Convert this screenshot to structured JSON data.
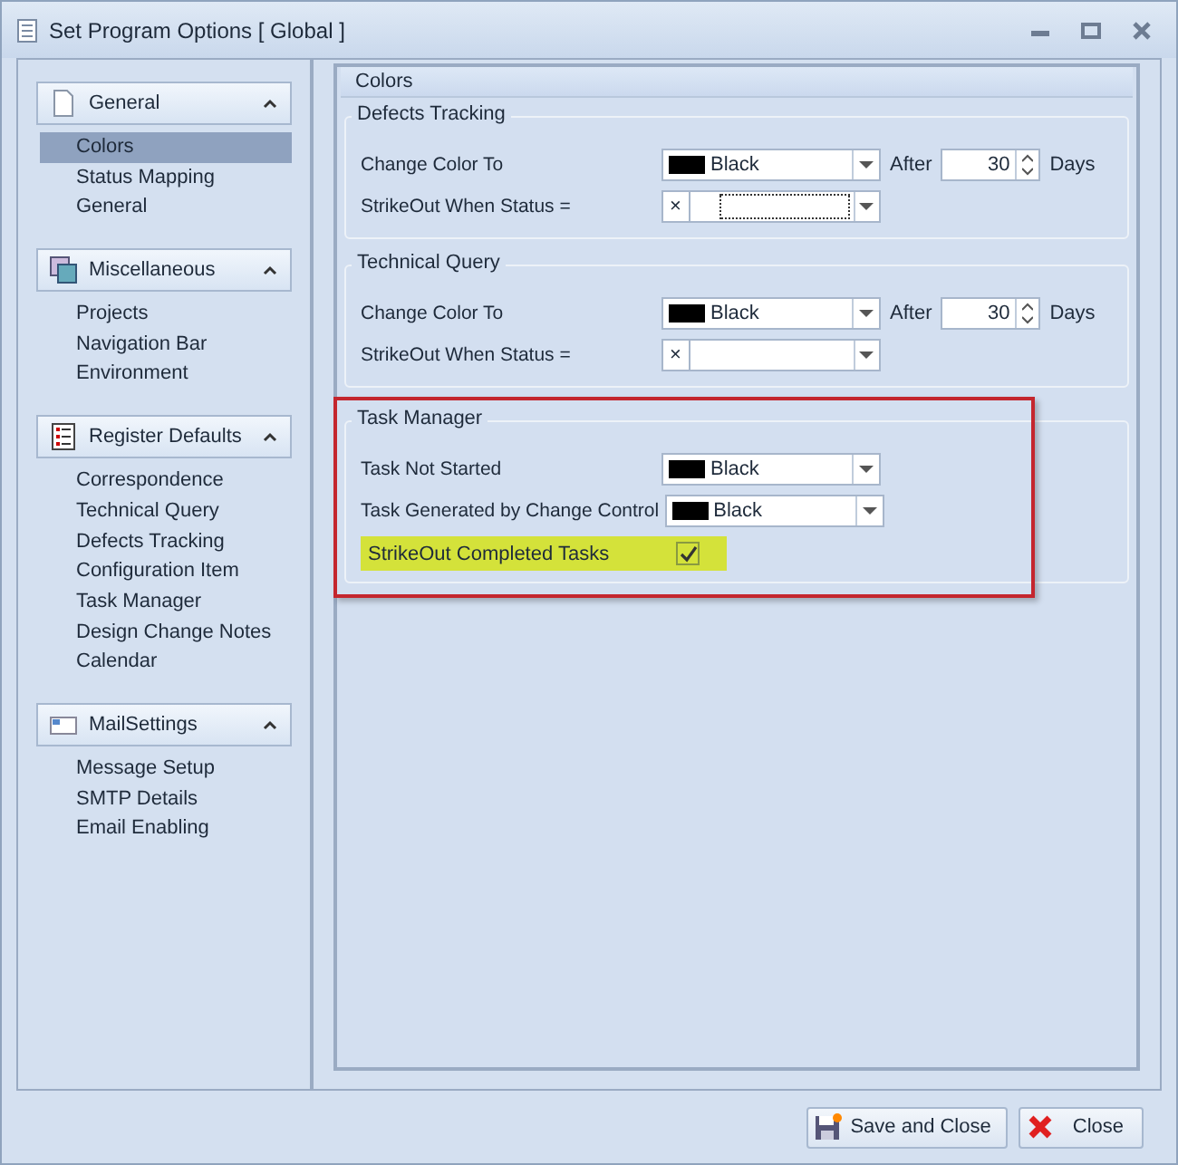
{
  "window": {
    "title": "Set Program Options [ Global ]"
  },
  "sidebar": [
    {
      "title": "General",
      "expanded": true,
      "items": [
        {
          "label": "Colors",
          "selected": true
        },
        {
          "label": "Status Mapping",
          "selected": false
        },
        {
          "label": "General",
          "selected": false
        }
      ]
    },
    {
      "title": "Miscellaneous",
      "expanded": true,
      "items": [
        {
          "label": "Projects",
          "selected": false
        },
        {
          "label": "Navigation Bar",
          "selected": false
        },
        {
          "label": "Environment",
          "selected": false
        }
      ]
    },
    {
      "title": "Register Defaults",
      "expanded": true,
      "items": [
        {
          "label": "Correspondence",
          "selected": false
        },
        {
          "label": "Technical Query",
          "selected": false
        },
        {
          "label": "Defects Tracking",
          "selected": false
        },
        {
          "label": "Configuration Item",
          "selected": false
        },
        {
          "label": "Task Manager",
          "selected": false
        },
        {
          "label": "Design Change Notes",
          "selected": false
        },
        {
          "label": "Calendar",
          "selected": false
        }
      ]
    },
    {
      "title": "MailSettings",
      "expanded": true,
      "items": [
        {
          "label": "Message Setup",
          "selected": false
        },
        {
          "label": "SMTP Details",
          "selected": false
        },
        {
          "label": "Email Enabling",
          "selected": false
        }
      ]
    }
  ],
  "panel": {
    "title": "Colors",
    "groups": [
      {
        "title": "Defects Tracking",
        "highlighted": false,
        "rows": [
          {
            "kind": "color_after",
            "label": "Change Color To",
            "color": "#000000",
            "value": "Black",
            "after_label": "After",
            "days": "30",
            "days_label": "Days"
          },
          {
            "kind": "status",
            "label": "StrikeOut When Status =",
            "clear": "×",
            "focused": true
          }
        ]
      },
      {
        "title": "Technical Query",
        "highlighted": false,
        "rows": [
          {
            "kind": "color_after",
            "label": "Change Color To",
            "color": "#000000",
            "value": "Black",
            "after_label": "After",
            "days": "30",
            "days_label": "Days"
          },
          {
            "kind": "status",
            "label": "StrikeOut When Status =",
            "clear": "×",
            "focused": false
          }
        ]
      },
      {
        "title": "Task Manager",
        "highlighted": true,
        "rows": [
          {
            "kind": "color",
            "label": "Task Not Started",
            "color": "#000000",
            "value": "Black"
          },
          {
            "kind": "color",
            "label": "Task Generated by Change Control",
            "color": "#000000",
            "value": "Black"
          },
          {
            "kind": "checkbox",
            "label": "StrikeOut Completed Tasks",
            "checked": true,
            "highlighted": true
          }
        ]
      }
    ]
  },
  "buttons": [
    {
      "label": "Save and Close"
    },
    {
      "label": "Close"
    }
  ]
}
